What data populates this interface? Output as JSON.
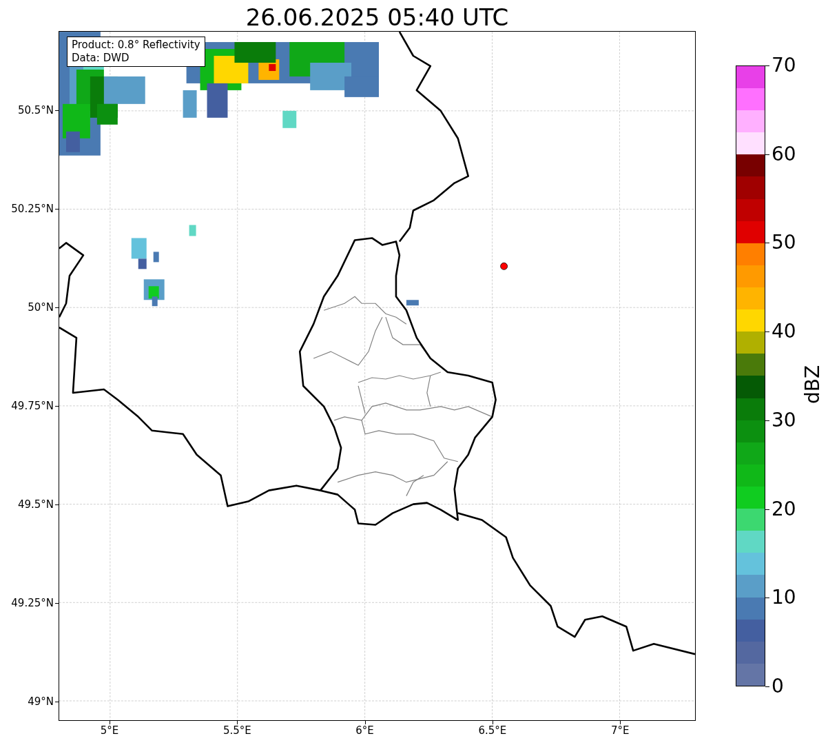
{
  "title": "26.06.2025 05:40 UTC",
  "info_box": [
    "Product: 0.8° Reflectivity",
    "Data: DWD"
  ],
  "y_ticks": [
    "50.5°N",
    "50.25°N",
    "50°N",
    "49.75°N",
    "49.5°N",
    "49.25°N",
    "49°N"
  ],
  "x_ticks": [
    "5°E",
    "5.5°E",
    "6°E",
    "6.5°E",
    "7°E"
  ],
  "colorbar": {
    "label": "dBZ",
    "ticks": [
      "70",
      "60",
      "50",
      "40",
      "30",
      "20",
      "10",
      "0"
    ],
    "bands": [
      {
        "color": "#6475a6"
      },
      {
        "color": "#5468a0"
      },
      {
        "color": "#445fa0"
      },
      {
        "color": "#4a7ab2"
      },
      {
        "color": "#5a9ec8"
      },
      {
        "color": "#64c2dc"
      },
      {
        "color": "#60d8c4"
      },
      {
        "color": "#3cd870"
      },
      {
        "color": "#10cc20"
      },
      {
        "color": "#10b818"
      },
      {
        "color": "#10a818"
      },
      {
        "color": "#0c9010"
      },
      {
        "color": "#0a7c0a"
      },
      {
        "color": "#055a05"
      },
      {
        "color": "#4a7a0a"
      },
      {
        "color": "#b0b000"
      },
      {
        "color": "#ffd700"
      },
      {
        "color": "#ffb400"
      },
      {
        "color": "#ff9a00"
      },
      {
        "color": "#ff7f00"
      },
      {
        "color": "#e00000"
      },
      {
        "color": "#c00000"
      },
      {
        "color": "#a00000"
      },
      {
        "color": "#780000"
      },
      {
        "color": "#ffe0ff"
      },
      {
        "color": "#ffb0ff"
      },
      {
        "color": "#ff70ff"
      },
      {
        "color": "#e840e8"
      }
    ]
  }
}
